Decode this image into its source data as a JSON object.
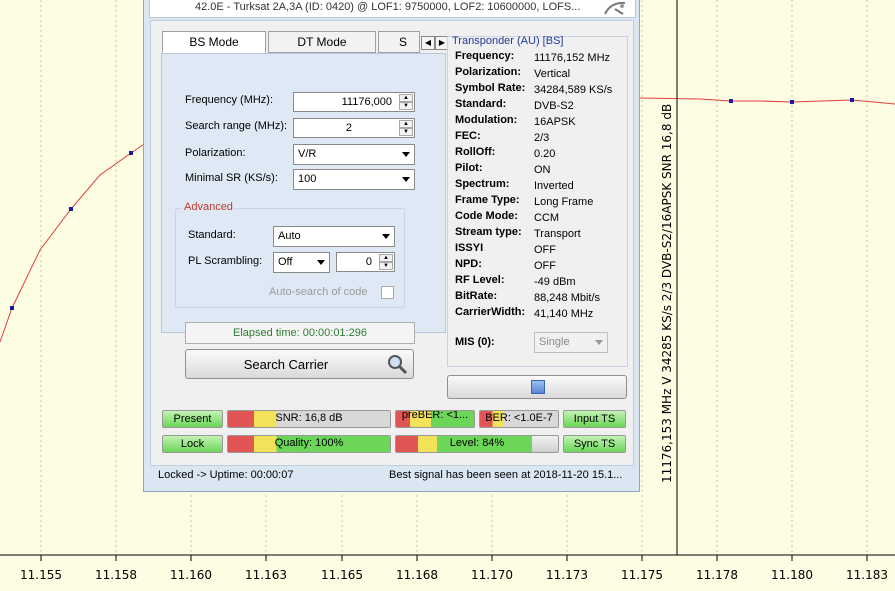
{
  "window": {
    "title": "42.0E - Turksat 2A,3A (ID: 0420) @ LOF1: 9750000, LOF2: 10600000, LOFS..."
  },
  "tabs": [
    {
      "label": "BS Mode",
      "active": true
    },
    {
      "label": "DT Mode",
      "active": false
    },
    {
      "label": "S",
      "active": false
    }
  ],
  "form": {
    "frequency_label": "Frequency (MHz):",
    "frequency_value": "11176,000",
    "search_range_label": "Search range (MHz):",
    "search_range_value": "2",
    "polarization_label": "Polarization:",
    "polarization_value": "V/R",
    "minimal_sr_label": "Minimal SR (KS/s):",
    "minimal_sr_value": "100"
  },
  "advanced": {
    "title": "Advanced",
    "standard_label": "Standard:",
    "standard_value": "Auto",
    "pl_scrambling_label": "PL Scrambling:",
    "pl_scrambling_value": "Off",
    "pl_scrambling_number": "0",
    "autosearch_label": "Auto-search of code"
  },
  "elapsed": "Elapsed time: 00:00:01:296",
  "search_button": "Search Carrier",
  "transponder": {
    "title": "Transponder (AU) [BS]",
    "rows": [
      {
        "key": "Frequency:",
        "value": "11176,152 MHz"
      },
      {
        "key": "Polarization:",
        "value": "Vertical"
      },
      {
        "key": "Symbol Rate:",
        "value": "34284,589 KS/s"
      },
      {
        "key": "Standard:",
        "value": "DVB-S2"
      },
      {
        "key": "Modulation:",
        "value": "16APSK"
      },
      {
        "key": "FEC:",
        "value": "2/3"
      },
      {
        "key": "RollOff:",
        "value": "0.20"
      },
      {
        "key": "Pilot:",
        "value": "ON"
      },
      {
        "key": "Spectrum:",
        "value": "Inverted"
      },
      {
        "key": "Frame Type:",
        "value": "Long Frame"
      },
      {
        "key": "Code Mode:",
        "value": "CCM"
      },
      {
        "key": "Stream type:",
        "value": "Transport"
      },
      {
        "key": "ISSYI",
        "value": "OFF"
      },
      {
        "key": "NPD:",
        "value": "OFF"
      },
      {
        "key": "RF Level:",
        "value": "-49 dBm"
      },
      {
        "key": "BitRate:",
        "value": "88,248 Mbit/s"
      },
      {
        "key": "CarrierWidth:",
        "value": "41,140 MHz"
      }
    ],
    "mis_label": "MIS (0):",
    "mis_value": "Single"
  },
  "indicators": {
    "present": "Present",
    "lock": "Lock",
    "snr": "SNR: 16,8 dB",
    "quality": "Quality: 100%",
    "quality_level": 1.0,
    "preber": "preBER: <1...",
    "ber": "BER: <1.0E-7",
    "level": "Level: 84%",
    "level_value": 0.84,
    "input_ts": "Input TS",
    "sync_ts": "Sync TS"
  },
  "status": {
    "left": "Locked -> Uptime: 00:00:07",
    "right": "Best signal has been seen at 2018-11-20 15.1..."
  },
  "plot": {
    "x_ticks": [
      "11.155",
      "11.158",
      "11.160",
      "11.163",
      "11.165",
      "11.168",
      "11.170",
      "11.173",
      "11.175",
      "11.178",
      "11.180",
      "11.183"
    ],
    "marker_label": "11176,153 MHz V 34285 KS/s 2/3 DVB-S2/16APSK SNR 16,8 dB",
    "colors": {
      "background": "#fdfde4",
      "curve": "#e04040",
      "points": "#1a1aa0"
    }
  }
}
